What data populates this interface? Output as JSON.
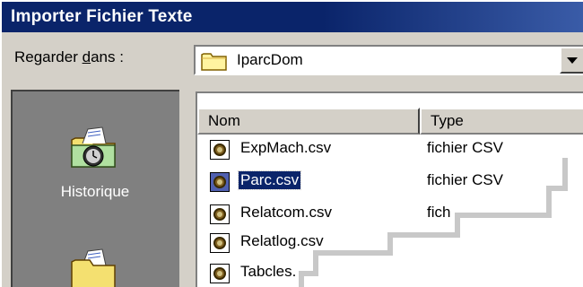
{
  "window": {
    "title": "Importer Fichier Texte"
  },
  "look_in": {
    "label_before": "Regarder ",
    "label_underlined": "d",
    "label_after": "ans :",
    "value": "IparcDom",
    "folder_icon": "folder-icon"
  },
  "places_bar": {
    "items": [
      {
        "label": "Historique",
        "icon": "history-icon"
      },
      {
        "label": "",
        "icon": "folder-documents-icon"
      }
    ]
  },
  "file_list": {
    "columns": [
      "Nom",
      "Type"
    ],
    "rows": [
      {
        "name": "ExpMach.csv",
        "type": "fichier CSV",
        "selected": false
      },
      {
        "name": "Parc.csv",
        "type": "fichier CSV",
        "selected": true
      },
      {
        "name": "Relatcom.csv",
        "type": "fich",
        "selected": false
      },
      {
        "name": "Relatlog.csv",
        "type": "",
        "selected": false
      },
      {
        "name": "Tabcles.",
        "type": "",
        "selected": false
      }
    ],
    "icon": "csv-file-icon"
  },
  "colors": {
    "titlebar": "#0a246a",
    "face": "#d4d0c8",
    "places_bg": "#808080",
    "selection": "#0a246a"
  }
}
